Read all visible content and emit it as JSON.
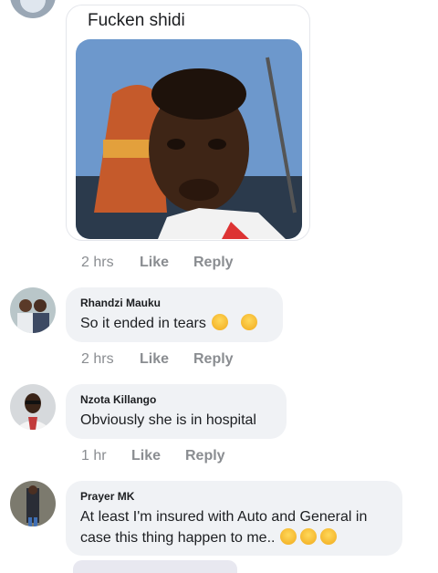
{
  "post_image_comment": {
    "caption": "Fucken shidi",
    "time": "2 hrs",
    "like_label": "Like",
    "reply_label": "Reply"
  },
  "comments": [
    {
      "author": "Rhandzi Mauku",
      "text": "So it ended in tears",
      "emojis": [
        "rofl-emoji",
        "rofl-emoji"
      ],
      "time": "2 hrs",
      "like_label": "Like",
      "reply_label": "Reply"
    },
    {
      "author": "Nzota Killango",
      "text": "Obviously she is in hospital",
      "time": "1 hr",
      "like_label": "Like",
      "reply_label": "Reply"
    },
    {
      "author": "Prayer MK",
      "text_line1": "At least I'm insured with Auto and General in",
      "text_line2": "case this thing happen to me..",
      "emojis": [
        "rofl-emoji",
        "joy-emoji",
        "joy-emoji"
      ]
    }
  ],
  "colors": {
    "bubble": "#f0f2f5",
    "meta_text": "#8a8d91",
    "emoji": "#f7c629"
  }
}
